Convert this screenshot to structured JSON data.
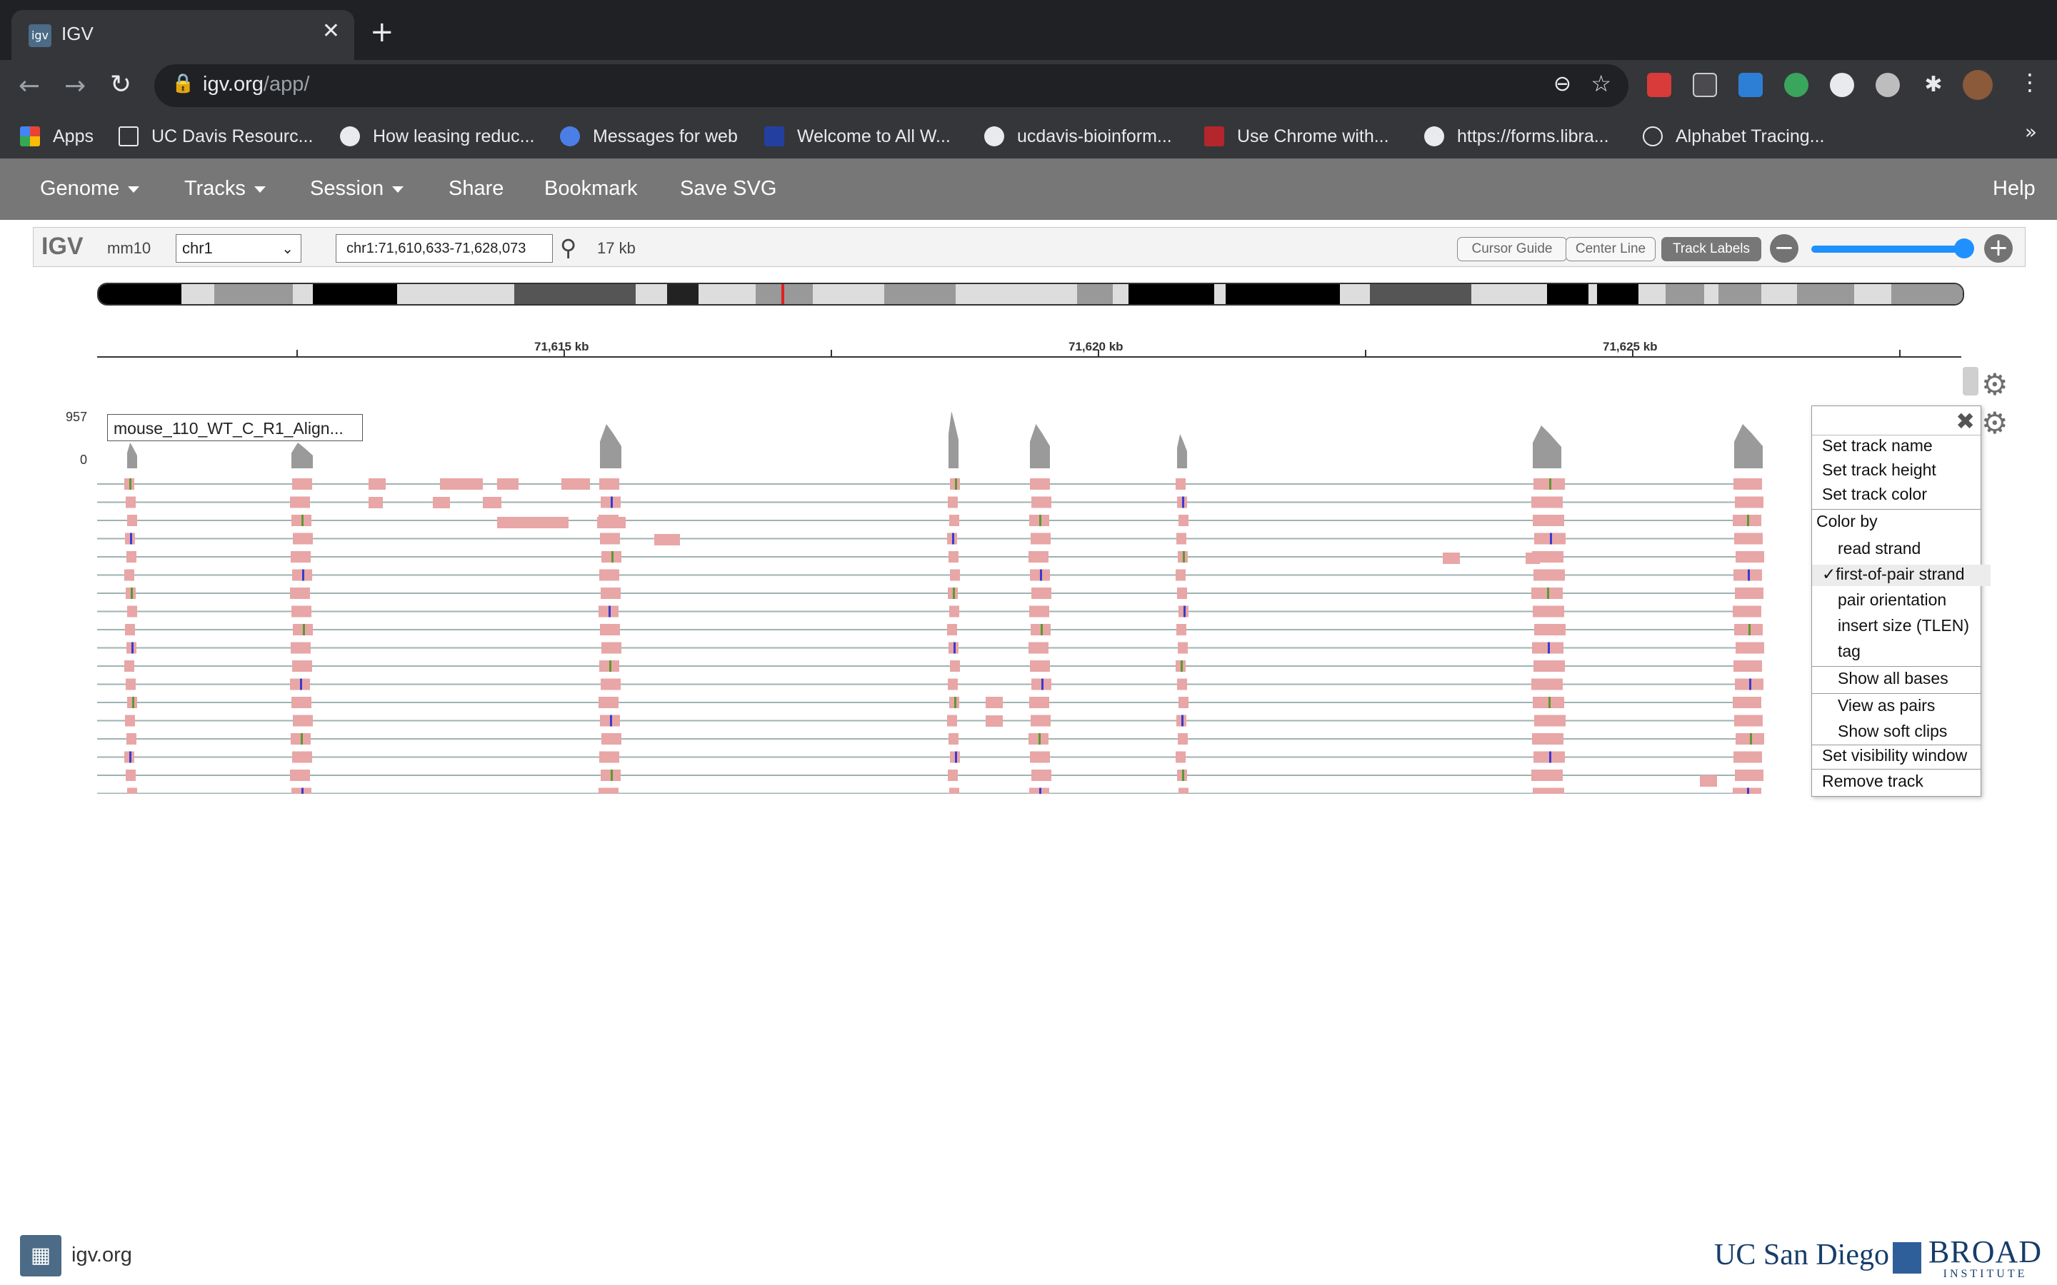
{
  "browser": {
    "tab": {
      "title": "IGV",
      "favicon": "igv-favicon-icon"
    },
    "url": {
      "host": "igv.org",
      "path": "/app/"
    },
    "bookmarks": [
      {
        "label": "Apps",
        "icon": "apps-grid-icon"
      },
      {
        "label": "UC Davis Resourc...",
        "icon": "folder-icon"
      },
      {
        "label": "How leasing reduc...",
        "icon": "globe-icon"
      },
      {
        "label": "Messages for web",
        "icon": "messages-icon"
      },
      {
        "label": "Welcome to All W...",
        "icon": "figure-icon"
      },
      {
        "label": "ucdavis-bioinform...",
        "icon": "globe-icon"
      },
      {
        "label": "Use Chrome with...",
        "icon": "shield-icon"
      },
      {
        "label": "https://forms.libra...",
        "icon": "globe-icon"
      },
      {
        "label": "Alphabet Tracing...",
        "icon": "wordpress-icon"
      }
    ],
    "more_bookmarks": "»"
  },
  "igv_nav": {
    "genome": "Genome",
    "tracks": "Tracks",
    "session": "Session",
    "share": "Share",
    "bookmark": "Bookmark",
    "save_svg": "Save SVG",
    "help": "Help"
  },
  "controls": {
    "logo": "IGV",
    "genome_id": "mm10",
    "chromosome": "chr1",
    "locus": "chr1:71,610,633-71,628,073",
    "window_width": "17 kb",
    "cursor_guide": "Cursor Guide",
    "center_line": "Center Line",
    "track_labels": "Track Labels",
    "zoom_level": 0.93
  },
  "ruler": {
    "ticks": [
      "71,615 kb",
      "71,620 kb",
      "71,625 kb"
    ]
  },
  "track": {
    "name": "mouse_110_WT_C_R1_Align...",
    "scale_max": "957",
    "scale_min": "0",
    "read_color": "#e8a6a6",
    "coverage_color": "#9a9a9a"
  },
  "popup_menu": {
    "items": [
      "Set track name",
      "Set track height",
      "Set track color",
      "Color by",
      "read strand",
      "first-of-pair strand",
      "pair orientation",
      "insert size (TLEN)",
      "tag",
      "Show all bases",
      "View as pairs",
      "Show soft clips",
      "Set visibility window",
      "Remove track"
    ],
    "checked": "✓"
  },
  "footer": {
    "site": "igv.org",
    "ucsd": "UC San Diego",
    "broad": "BROAD",
    "broad_sub": "INSTITUTE"
  }
}
